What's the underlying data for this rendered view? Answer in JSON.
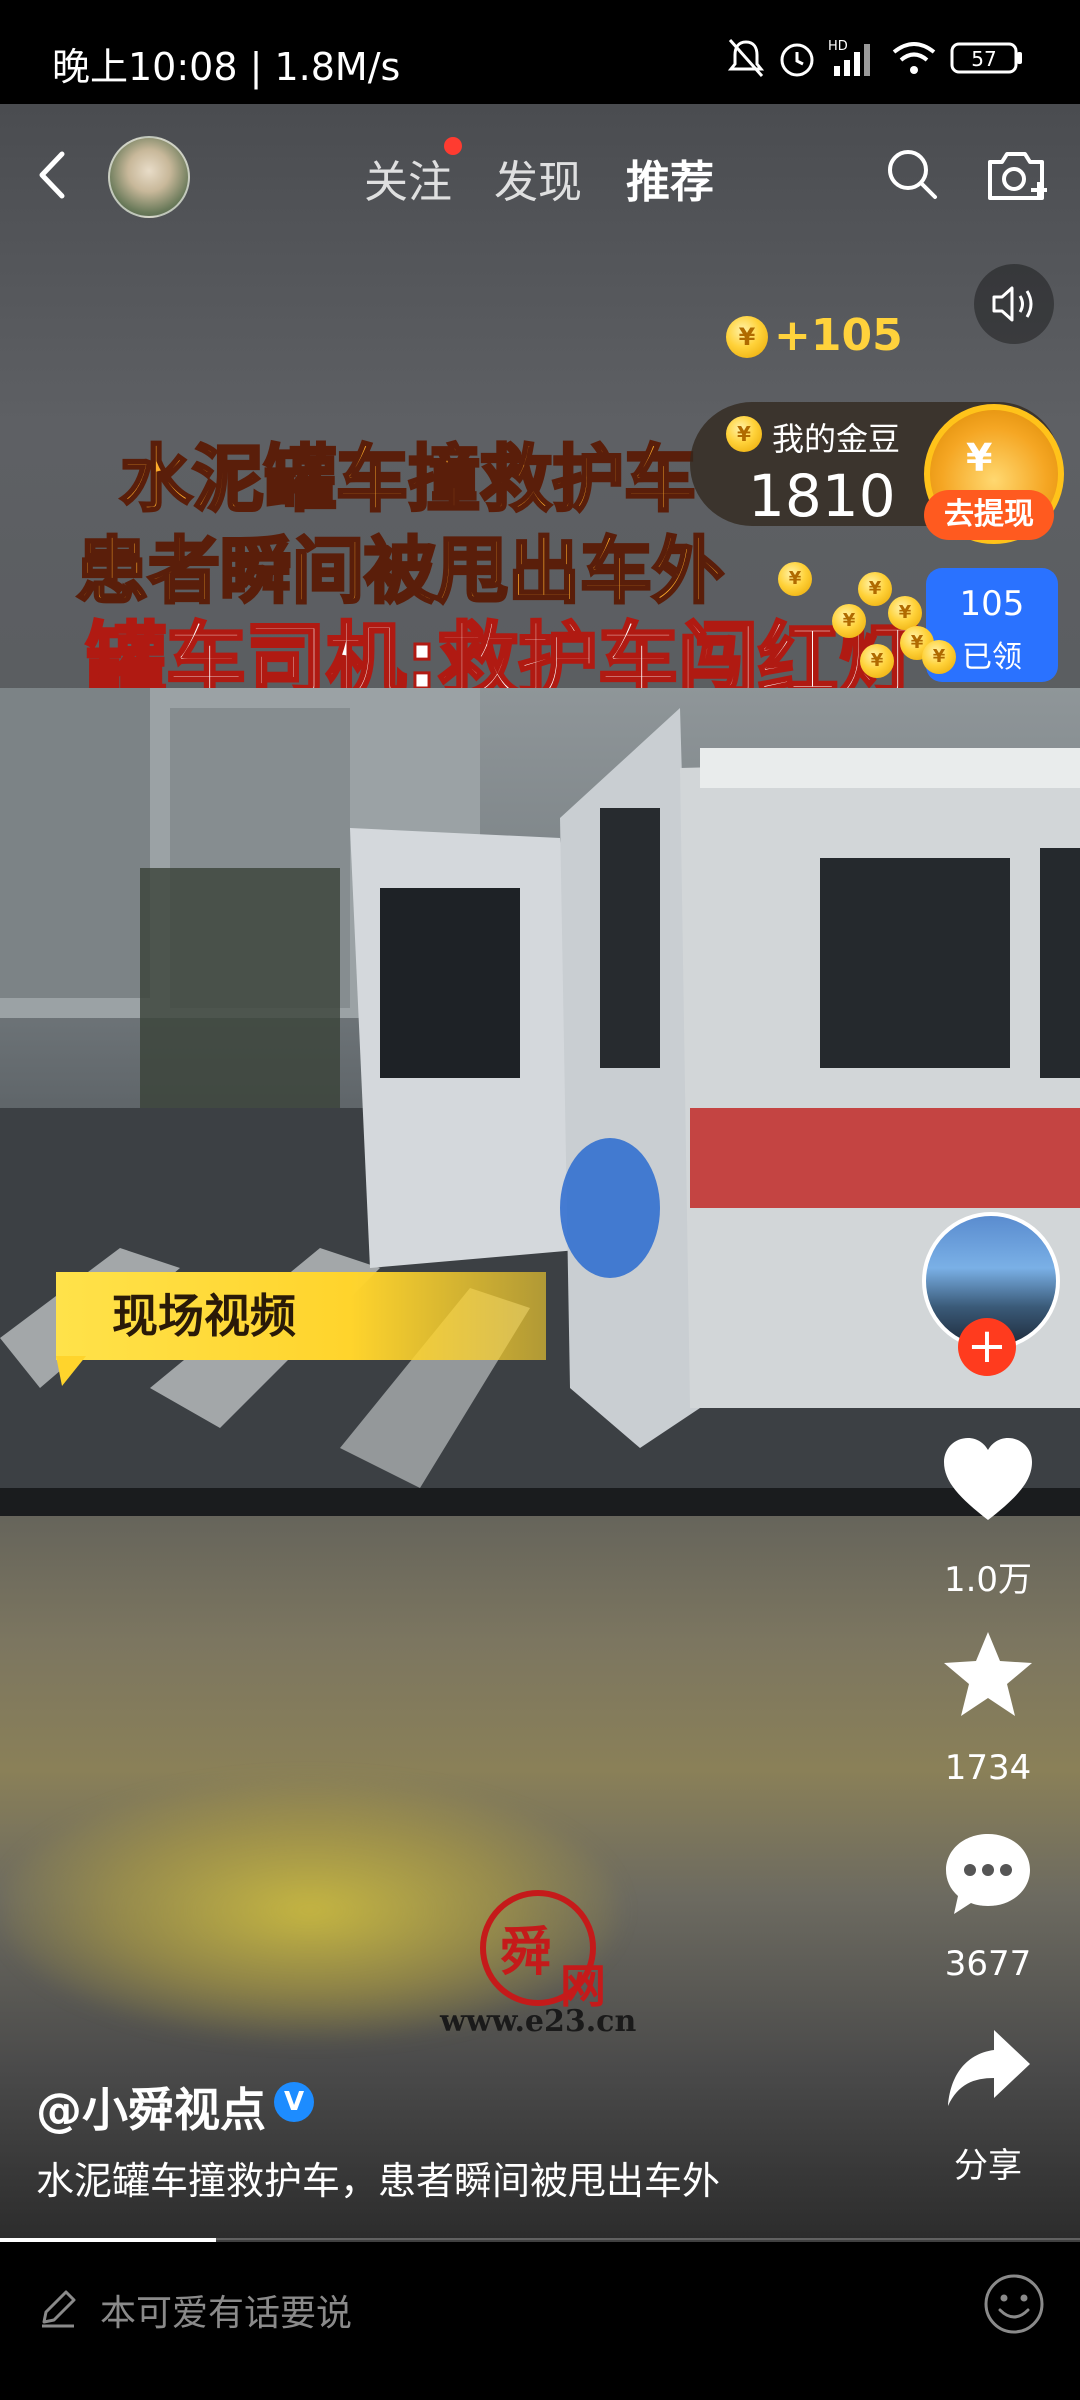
{
  "status_bar": {
    "time": "晚上10:08 | 1.8M/s",
    "battery": "57"
  },
  "nav": {
    "tabs": [
      "关注",
      "发现",
      "推荐"
    ],
    "active_tab": "推荐"
  },
  "video": {
    "headline_line1": "水泥罐车撞救护车",
    "headline_line2": "患者瞬间被甩出车外",
    "headline_line3": "罐车司机:救护车闯红灯",
    "tag": "现场视频",
    "watermark_url": "www.e23.cn",
    "watermark_text": "舜网",
    "progress": 0.2
  },
  "coins": {
    "reward": "+105",
    "label": "我的金豆",
    "count": "1810",
    "withdraw": "去提现",
    "claimed_count": "105",
    "claimed_label": "已领"
  },
  "actions": {
    "likes": "1.0万",
    "favorites": "1734",
    "comments": "3677",
    "share": "分享"
  },
  "post": {
    "author": "@小舜视点",
    "caption": "水泥罐车撞救护车，患者瞬间被甩出车外"
  },
  "comment_bar": {
    "placeholder": "本可爱有话要说"
  }
}
